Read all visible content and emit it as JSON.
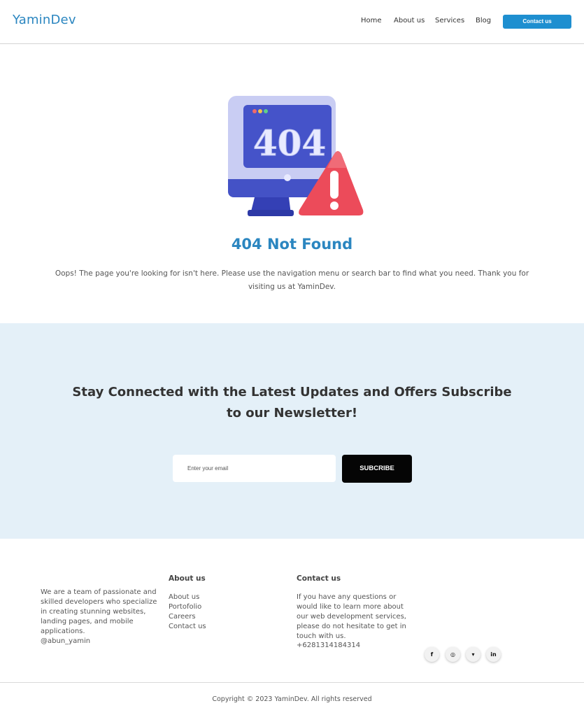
{
  "header": {
    "logo": "YaminDev",
    "nav": [
      "Home",
      "About us",
      "Services",
      "Blog"
    ],
    "contact_button": "Contact us"
  },
  "illustration": {
    "screen_text": "404",
    "monitor_icon": "monitor-icon",
    "warning_icon": "warning-triangle-icon"
  },
  "error": {
    "title": "404 Not Found",
    "description": "Oops! The page you're looking for isn't here. Please use the navigation menu or search bar to find what you need. Thank you for visiting us at YaminDev."
  },
  "newsletter": {
    "title": "Stay Connected with the Latest Updates and Offers Subscribe to our Newsletter!",
    "email_placeholder": "Enter your email",
    "subscribe_label": "SUBCRIBE"
  },
  "footer": {
    "about_text": "We are a team of passionate and skilled developers who specialize in creating stunning websites, landing pages, and mobile applications.",
    "handle": "@abun_yamin",
    "about_heading": "About us",
    "links": [
      "About us",
      "Portofolio",
      "Careers",
      "Contact us"
    ],
    "contact_heading": "Contact us",
    "contact_text": "If you have any questions or would like to learn more about our web development services, please do not hesitate to get in touch with us.",
    "phone": "+6281314184314",
    "social": [
      {
        "name": "facebook-icon",
        "glyph": "f"
      },
      {
        "name": "instagram-icon",
        "glyph": "◎"
      },
      {
        "name": "twitter-icon",
        "glyph": "▾"
      },
      {
        "name": "linkedin-icon",
        "glyph": "in"
      }
    ],
    "copyright": "Copyright © 2023 YaminDev. All rights reserved"
  },
  "colors": {
    "brand": "#2b86c0",
    "button": "#1e8fd0",
    "newsletter_bg": "#e4f0f8",
    "subscribe_bg": "#050505",
    "screen": "#4553c9",
    "warning": "#ec4b5a"
  }
}
